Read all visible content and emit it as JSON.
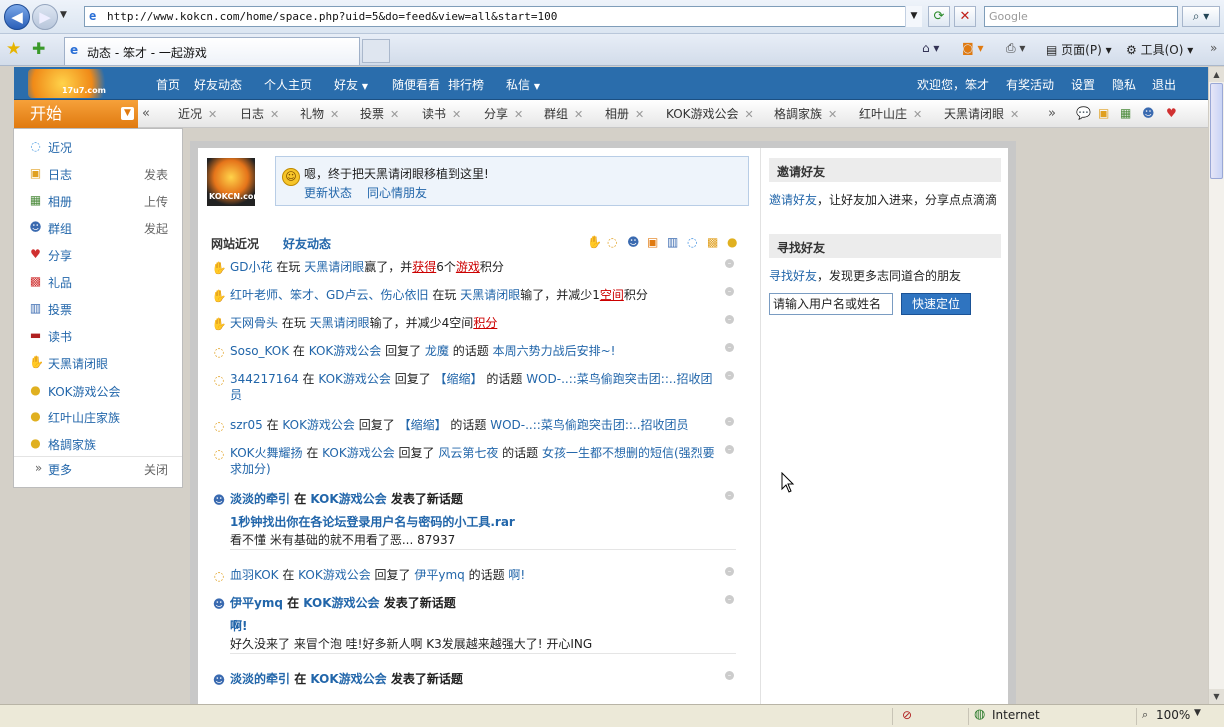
{
  "browser": {
    "url": "http://www.kokcn.com/home/space.php?uid=5&do=feed&view=all&start=100",
    "search_placeholder": "Google",
    "tab_title": "动态 - 笨才 - 一起游戏",
    "toolbar": {
      "page": "页面(P)",
      "tools": "工具(O)"
    },
    "status_zone": "Internet",
    "zoom": "100%"
  },
  "topnav": {
    "logo_text": "17u7.com",
    "items": [
      "首页",
      "好友动态",
      "个人主页",
      "好友",
      "随便看看",
      "排行榜",
      "私信"
    ],
    "right": [
      "欢迎您，笨才",
      "有奖活动",
      "设置",
      "隐私",
      "退出"
    ]
  },
  "start": {
    "label": "开始"
  },
  "apptabs": [
    "近况",
    "日志",
    "礼物",
    "投票",
    "读书",
    "分享",
    "群组",
    "相册",
    "KOK游戏公会",
    "格調家族",
    "红叶山庄",
    "天黑请闭眼"
  ],
  "sidebar": {
    "items": [
      {
        "label": "近况",
        "action": ""
      },
      {
        "label": "日志",
        "action": "发表"
      },
      {
        "label": "相册",
        "action": "上传"
      },
      {
        "label": "群组",
        "action": "发起"
      },
      {
        "label": "分享",
        "action": ""
      },
      {
        "label": "礼品",
        "action": ""
      },
      {
        "label": "投票",
        "action": ""
      },
      {
        "label": "读书",
        "action": ""
      },
      {
        "label": "天黑请闭眼",
        "action": ""
      },
      {
        "label": "KOK游戏公会",
        "action": ""
      },
      {
        "label": "红叶山庄家族",
        "action": ""
      },
      {
        "label": "格調家族",
        "action": ""
      }
    ],
    "more": "更多",
    "close": "关闭"
  },
  "profile": {
    "avatar_text": "KOKCN.com",
    "status_msg": "嗯，终于把天黑请闭眼移植到这里!",
    "update_link": "更新状态",
    "mood_link": "同心情朋友"
  },
  "feed_tabs": {
    "site": "网站近况",
    "friends": "好友动态"
  },
  "feed": [
    {
      "parts": [
        "GD小花",
        " 在玩 ",
        "天黑请闭眼",
        "赢了，并",
        "获得",
        "6个",
        "游戏",
        "积分"
      ]
    },
    {
      "parts": [
        "红叶老师、笨才、GD卢云、伤心依旧",
        " 在玩 ",
        "天黑请闭眼",
        "输了，并减少1",
        "空间",
        "积分"
      ]
    },
    {
      "parts": [
        "天网骨头",
        " 在玩 ",
        "天黑请闭眼",
        "输了，并减少4空间",
        "积分"
      ]
    },
    {
      "parts": [
        "Soso_KOK",
        " 在 ",
        "KOK游戏公会",
        " 回复了 ",
        "龙魔",
        " 的话题 ",
        "本周六势力战后安排~!"
      ]
    },
    {
      "parts": [
        "344217164",
        " 在 ",
        "KOK游戏公会",
        " 回复了 ",
        "【缩缩】",
        " 的话题 ",
        "WOD-..::菜鸟偷跑突击团::..招收团员"
      ]
    },
    {
      "parts": [
        "szr05",
        " 在 ",
        "KOK游戏公会",
        " 回复了 ",
        "【缩缩】",
        " 的话题 ",
        "WOD-..::菜鸟偷跑突击团::..招收团员"
      ]
    },
    {
      "parts": [
        "KOK火舞耀扬",
        " 在 ",
        "KOK游戏公会",
        " 回复了 ",
        "风云第七夜",
        " 的话题 ",
        "女孩一生都不想删的短信(强烈要求加分)"
      ]
    },
    {
      "parts": [
        "淡淡的牵引",
        " 在 ",
        "KOK游戏公会",
        " 发表了新话题"
      ],
      "title": "1秒钟找出你在各论坛登录用户名与密码的小工具.rar",
      "body": "看不懂 米有基础的就不用看了恶... 87937"
    },
    {
      "parts": [
        "血羽KOK",
        " 在 ",
        "KOK游戏公会",
        " 回复了 ",
        "伊平ymq",
        " 的话题 ",
        "啊!"
      ]
    },
    {
      "parts": [
        "伊平ymq",
        " 在 ",
        "KOK游戏公会",
        " 发表了新话题"
      ],
      "title": "啊!",
      "body": "好久没来了 来冒个泡 哇!好多新人啊 K3发展越来越强大了! 开心ING"
    },
    {
      "parts": [
        "淡淡的牵引",
        " 在 ",
        "KOK游戏公会",
        " 发表了新话题"
      ]
    }
  ],
  "right": {
    "invite_title": "邀请好友",
    "invite_link": "邀请好友",
    "invite_text": "，让好友加入进来，分享点点滴滴",
    "find_title": "寻找好友",
    "find_link": "寻找好友",
    "find_text": "，发现更多志同道合的朋友",
    "input_value": "请输入用户名或姓名",
    "locate_button": "快速定位"
  },
  "colors": {
    "nav_blue": "#2a6dac",
    "start_orange": "#e07a10",
    "link": "#2266aa",
    "alert_red": "#cc0000"
  }
}
